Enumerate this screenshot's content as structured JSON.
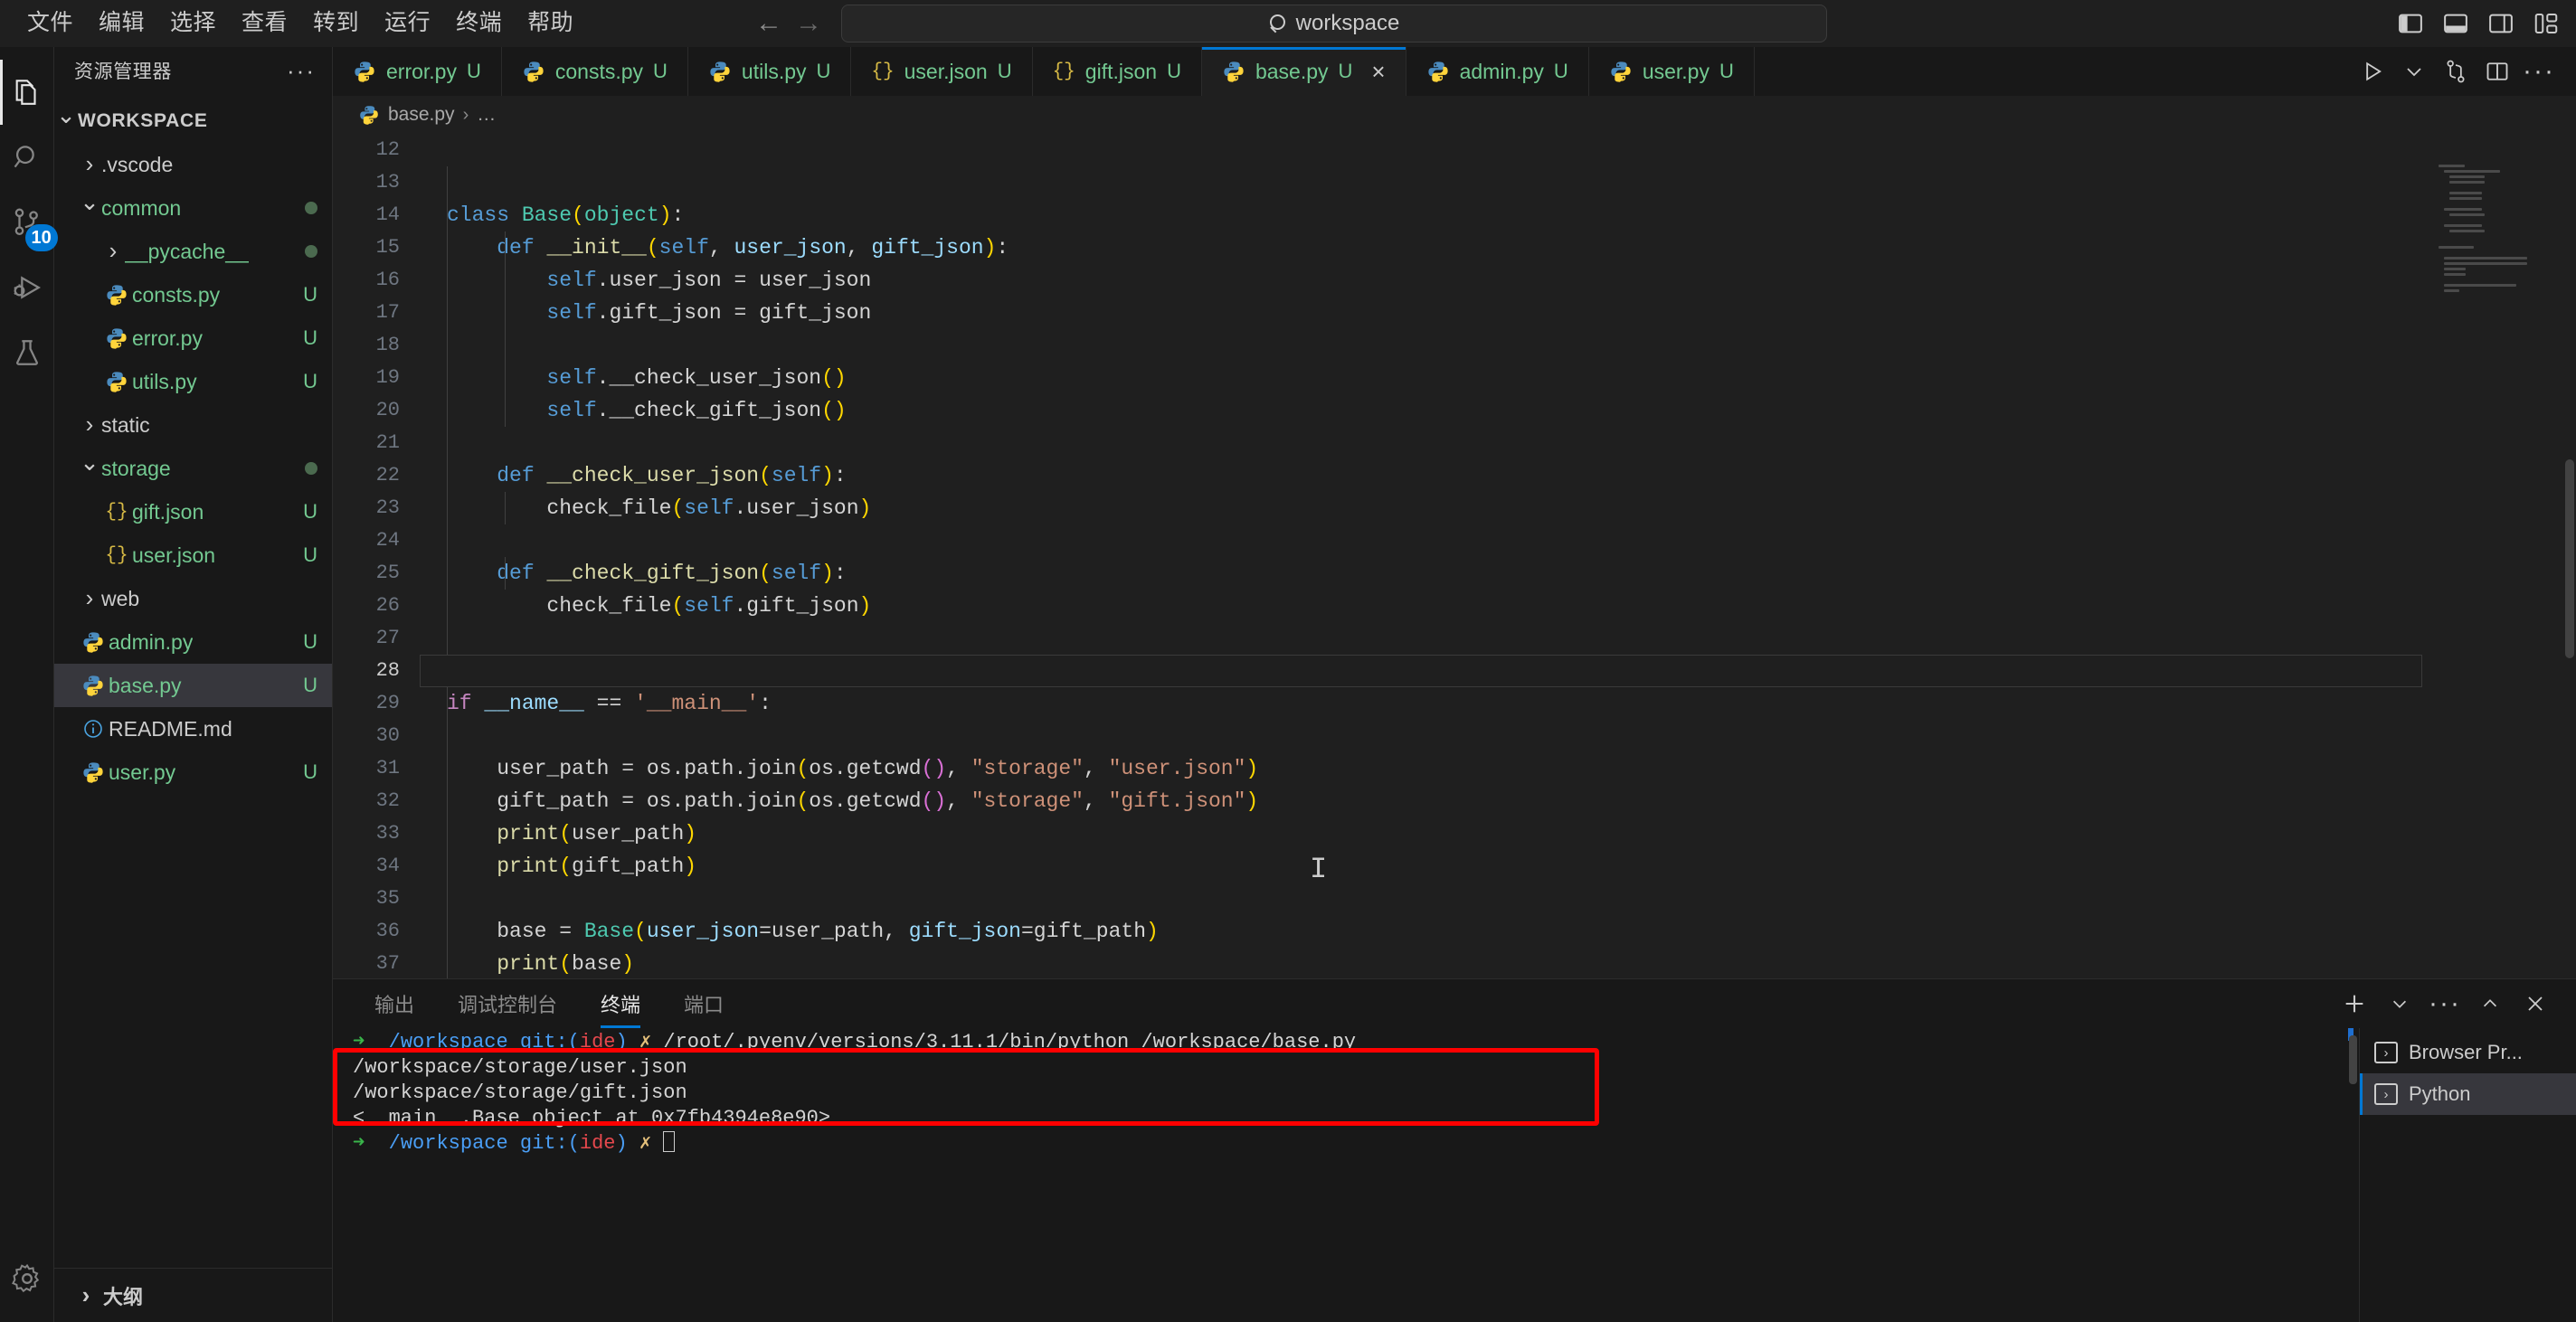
{
  "titlebar": {
    "menu": [
      "文件",
      "编辑",
      "选择",
      "查看",
      "转到",
      "运行",
      "终端",
      "帮助"
    ],
    "back_label": "←",
    "forward_label": "→",
    "command_center_text": "workspace",
    "layout_icons": [
      "toggle-primary-sidebar",
      "toggle-panel",
      "toggle-secondary-sidebar",
      "customize-layout"
    ]
  },
  "activitybar": {
    "items": [
      {
        "name": "explorer",
        "icon": "files-icon",
        "active": true,
        "badge": ""
      },
      {
        "name": "search",
        "icon": "search-icon",
        "active": false,
        "badge": ""
      },
      {
        "name": "source-control",
        "icon": "source-control-icon",
        "active": false,
        "badge": "10"
      },
      {
        "name": "run-and-debug",
        "icon": "run-debug-icon",
        "active": false,
        "badge": ""
      },
      {
        "name": "testing",
        "icon": "beaker-icon",
        "active": false,
        "badge": ""
      }
    ],
    "bottom": [
      {
        "name": "manage",
        "icon": "gear-icon"
      }
    ]
  },
  "sidebar": {
    "title": "资源管理器",
    "more_label": "···",
    "root": "WORKSPACE",
    "outline_label": "大纲",
    "tree": [
      {
        "label": ".vscode",
        "indent": 1,
        "type": "folder",
        "state": "collapsed",
        "color": "white",
        "badge": "",
        "dot": false,
        "selected": false
      },
      {
        "label": "common",
        "indent": 1,
        "type": "folder",
        "state": "expanded",
        "color": "green",
        "badge": "",
        "dot": true,
        "selected": false
      },
      {
        "label": "__pycache__",
        "indent": 2,
        "type": "folder",
        "state": "collapsed",
        "color": "green",
        "badge": "",
        "dot": true,
        "selected": false
      },
      {
        "label": "consts.py",
        "indent": 2,
        "type": "python",
        "state": "",
        "color": "green",
        "badge": "U",
        "dot": false,
        "selected": false
      },
      {
        "label": "error.py",
        "indent": 2,
        "type": "python",
        "state": "",
        "color": "green",
        "badge": "U",
        "dot": false,
        "selected": false
      },
      {
        "label": "utils.py",
        "indent": 2,
        "type": "python",
        "state": "",
        "color": "green",
        "badge": "U",
        "dot": false,
        "selected": false
      },
      {
        "label": "static",
        "indent": 1,
        "type": "folder",
        "state": "collapsed",
        "color": "white",
        "badge": "",
        "dot": false,
        "selected": false
      },
      {
        "label": "storage",
        "indent": 1,
        "type": "folder",
        "state": "expanded",
        "color": "green",
        "badge": "",
        "dot": true,
        "selected": false
      },
      {
        "label": "gift.json",
        "indent": 2,
        "type": "json",
        "state": "",
        "color": "green",
        "badge": "U",
        "dot": false,
        "selected": false
      },
      {
        "label": "user.json",
        "indent": 2,
        "type": "json",
        "state": "",
        "color": "green",
        "badge": "U",
        "dot": false,
        "selected": false
      },
      {
        "label": "web",
        "indent": 1,
        "type": "folder",
        "state": "collapsed",
        "color": "white",
        "badge": "",
        "dot": false,
        "selected": false
      },
      {
        "label": "admin.py",
        "indent": 1,
        "type": "python",
        "state": "",
        "color": "green",
        "badge": "U",
        "dot": false,
        "selected": false
      },
      {
        "label": "base.py",
        "indent": 1,
        "type": "python",
        "state": "",
        "color": "green",
        "badge": "U",
        "dot": false,
        "selected": true
      },
      {
        "label": "README.md",
        "indent": 1,
        "type": "md",
        "state": "",
        "color": "white",
        "badge": "",
        "dot": false,
        "selected": false
      },
      {
        "label": "user.py",
        "indent": 1,
        "type": "python",
        "state": "",
        "color": "green",
        "badge": "U",
        "dot": false,
        "selected": false
      }
    ]
  },
  "editor": {
    "tabs": [
      {
        "label": "error.py",
        "icon": "python-icon",
        "badge": "U",
        "active": false,
        "closable": false
      },
      {
        "label": "consts.py",
        "icon": "python-icon",
        "badge": "U",
        "active": false,
        "closable": false
      },
      {
        "label": "utils.py",
        "icon": "python-icon",
        "badge": "U",
        "active": false,
        "closable": false
      },
      {
        "label": "user.json",
        "icon": "json-icon",
        "badge": "U",
        "active": false,
        "closable": false
      },
      {
        "label": "gift.json",
        "icon": "json-icon",
        "badge": "U",
        "active": false,
        "closable": false
      },
      {
        "label": "base.py",
        "icon": "python-icon",
        "badge": "U",
        "active": true,
        "closable": true
      },
      {
        "label": "admin.py",
        "icon": "python-icon",
        "badge": "U",
        "active": false,
        "closable": false
      },
      {
        "label": "user.py",
        "icon": "python-icon",
        "badge": "U",
        "active": false,
        "closable": false
      }
    ],
    "tab_close_label": "×",
    "actions": [
      "run-python-file-icon",
      "chevron-down-icon",
      "split-branch-icon",
      "split-editor-icon",
      "more-actions-icon"
    ],
    "breadcrumb": {
      "file": "base.py",
      "separator": "›",
      "trail": "…"
    },
    "first_line_number": 12,
    "current_line": 28,
    "lines": [
      {
        "n": 12,
        "tokens": []
      },
      {
        "n": 13,
        "tokens": []
      },
      {
        "n": 14,
        "tokens": [
          {
            "t": "class ",
            "c": "k-kw"
          },
          {
            "t": "Base",
            "c": "k-cls"
          },
          {
            "t": "(",
            "c": "k-b1"
          },
          {
            "t": "object",
            "c": "k-cls"
          },
          {
            "t": ")",
            "c": "k-b1"
          },
          {
            "t": ":",
            "c": "k-txt"
          }
        ]
      },
      {
        "n": 15,
        "tokens": [
          {
            "t": "    ",
            "c": "k-txt"
          },
          {
            "t": "def ",
            "c": "k-kw"
          },
          {
            "t": "__init__",
            "c": "k-fn"
          },
          {
            "t": "(",
            "c": "k-b1"
          },
          {
            "t": "self",
            "c": "k-self"
          },
          {
            "t": ", ",
            "c": "k-txt"
          },
          {
            "t": "user_json",
            "c": "k-var"
          },
          {
            "t": ", ",
            "c": "k-txt"
          },
          {
            "t": "gift_json",
            "c": "k-var"
          },
          {
            "t": ")",
            "c": "k-b1"
          },
          {
            "t": ":",
            "c": "k-txt"
          }
        ]
      },
      {
        "n": 16,
        "tokens": [
          {
            "t": "        ",
            "c": "k-txt"
          },
          {
            "t": "self",
            "c": "k-self"
          },
          {
            "t": ".user_json = user_json",
            "c": "k-txt"
          }
        ]
      },
      {
        "n": 17,
        "tokens": [
          {
            "t": "        ",
            "c": "k-txt"
          },
          {
            "t": "self",
            "c": "k-self"
          },
          {
            "t": ".gift_json = gift_json",
            "c": "k-txt"
          }
        ]
      },
      {
        "n": 18,
        "tokens": []
      },
      {
        "n": 19,
        "tokens": [
          {
            "t": "        ",
            "c": "k-txt"
          },
          {
            "t": "self",
            "c": "k-self"
          },
          {
            "t": ".__check_user_json",
            "c": "k-txt"
          },
          {
            "t": "()",
            "c": "k-b1"
          }
        ]
      },
      {
        "n": 20,
        "tokens": [
          {
            "t": "        ",
            "c": "k-txt"
          },
          {
            "t": "self",
            "c": "k-self"
          },
          {
            "t": ".__check_gift_json",
            "c": "k-txt"
          },
          {
            "t": "()",
            "c": "k-b1"
          }
        ]
      },
      {
        "n": 21,
        "tokens": []
      },
      {
        "n": 22,
        "tokens": [
          {
            "t": "    ",
            "c": "k-txt"
          },
          {
            "t": "def ",
            "c": "k-kw"
          },
          {
            "t": "__check_user_json",
            "c": "k-fn"
          },
          {
            "t": "(",
            "c": "k-b1"
          },
          {
            "t": "self",
            "c": "k-self"
          },
          {
            "t": ")",
            "c": "k-b1"
          },
          {
            "t": ":",
            "c": "k-txt"
          }
        ]
      },
      {
        "n": 23,
        "tokens": [
          {
            "t": "        check_file",
            "c": "k-txt"
          },
          {
            "t": "(",
            "c": "k-b1"
          },
          {
            "t": "self",
            "c": "k-self"
          },
          {
            "t": ".user_json",
            "c": "k-txt"
          },
          {
            "t": ")",
            "c": "k-b1"
          }
        ]
      },
      {
        "n": 24,
        "tokens": []
      },
      {
        "n": 25,
        "tokens": [
          {
            "t": "    ",
            "c": "k-txt"
          },
          {
            "t": "def ",
            "c": "k-kw"
          },
          {
            "t": "__check_gift_json",
            "c": "k-fn"
          },
          {
            "t": "(",
            "c": "k-b1"
          },
          {
            "t": "self",
            "c": "k-self"
          },
          {
            "t": ")",
            "c": "k-b1"
          },
          {
            "t": ":",
            "c": "k-txt"
          }
        ]
      },
      {
        "n": 26,
        "tokens": [
          {
            "t": "        check_file",
            "c": "k-txt"
          },
          {
            "t": "(",
            "c": "k-b1"
          },
          {
            "t": "self",
            "c": "k-self"
          },
          {
            "t": ".gift_json",
            "c": "k-txt"
          },
          {
            "t": ")",
            "c": "k-b1"
          }
        ]
      },
      {
        "n": 27,
        "tokens": []
      },
      {
        "n": 28,
        "tokens": []
      },
      {
        "n": 29,
        "tokens": [
          {
            "t": "if ",
            "c": "k-ctrl"
          },
          {
            "t": "__name__",
            "c": "k-var"
          },
          {
            "t": " == ",
            "c": "k-txt"
          },
          {
            "t": "'__main__'",
            "c": "k-str"
          },
          {
            "t": ":",
            "c": "k-txt"
          }
        ]
      },
      {
        "n": 30,
        "tokens": []
      },
      {
        "n": 31,
        "tokens": [
          {
            "t": "    user_path = os.path.join",
            "c": "k-txt"
          },
          {
            "t": "(",
            "c": "k-b1"
          },
          {
            "t": "os.getcwd",
            "c": "k-txt"
          },
          {
            "t": "()",
            "c": "k-b2"
          },
          {
            "t": ", ",
            "c": "k-txt"
          },
          {
            "t": "\"storage\"",
            "c": "k-str"
          },
          {
            "t": ", ",
            "c": "k-txt"
          },
          {
            "t": "\"user.json\"",
            "c": "k-str"
          },
          {
            "t": ")",
            "c": "k-b1"
          }
        ]
      },
      {
        "n": 32,
        "tokens": [
          {
            "t": "    gift_path = os.path.join",
            "c": "k-txt"
          },
          {
            "t": "(",
            "c": "k-b1"
          },
          {
            "t": "os.getcwd",
            "c": "k-txt"
          },
          {
            "t": "()",
            "c": "k-b2"
          },
          {
            "t": ", ",
            "c": "k-txt"
          },
          {
            "t": "\"storage\"",
            "c": "k-str"
          },
          {
            "t": ", ",
            "c": "k-txt"
          },
          {
            "t": "\"gift.json\"",
            "c": "k-str"
          },
          {
            "t": ")",
            "c": "k-b1"
          }
        ]
      },
      {
        "n": 33,
        "tokens": [
          {
            "t": "    ",
            "c": "k-txt"
          },
          {
            "t": "print",
            "c": "k-fn"
          },
          {
            "t": "(",
            "c": "k-b1"
          },
          {
            "t": "user_path",
            "c": "k-txt"
          },
          {
            "t": ")",
            "c": "k-b1"
          }
        ]
      },
      {
        "n": 34,
        "tokens": [
          {
            "t": "    ",
            "c": "k-txt"
          },
          {
            "t": "print",
            "c": "k-fn"
          },
          {
            "t": "(",
            "c": "k-b1"
          },
          {
            "t": "gift_path",
            "c": "k-txt"
          },
          {
            "t": ")",
            "c": "k-b1"
          }
        ]
      },
      {
        "n": 35,
        "tokens": []
      },
      {
        "n": 36,
        "tokens": [
          {
            "t": "    base = ",
            "c": "k-txt"
          },
          {
            "t": "Base",
            "c": "k-cls"
          },
          {
            "t": "(",
            "c": "k-b1"
          },
          {
            "t": "user_json",
            "c": "k-var"
          },
          {
            "t": "=user_path, ",
            "c": "k-txt"
          },
          {
            "t": "gift_json",
            "c": "k-var"
          },
          {
            "t": "=gift_path",
            "c": "k-txt"
          },
          {
            "t": ")",
            "c": "k-b1"
          }
        ]
      },
      {
        "n": 37,
        "tokens": [
          {
            "t": "    ",
            "c": "k-txt"
          },
          {
            "t": "print",
            "c": "k-fn"
          },
          {
            "t": "(",
            "c": "k-b1"
          },
          {
            "t": "base",
            "c": "k-txt"
          },
          {
            "t": ")",
            "c": "k-b1"
          }
        ]
      }
    ]
  },
  "panel": {
    "tabs": [
      {
        "label": "输出",
        "active": false
      },
      {
        "label": "调试控制台",
        "active": false
      },
      {
        "label": "终端",
        "active": true
      },
      {
        "label": "端口",
        "active": false
      }
    ],
    "actions": [
      "add-terminal-icon",
      "chevron-down-icon",
      "more-actions-icon",
      "maximize-panel-icon",
      "close-panel-icon"
    ],
    "terminal": {
      "lines": [
        {
          "segments": [
            {
              "t": "➜  ",
              "c": "t-green"
            },
            {
              "t": "/workspace ",
              "c": "t-blue"
            },
            {
              "t": "git:(",
              "c": "t-blue"
            },
            {
              "t": "ide",
              "c": "t-red"
            },
            {
              "t": ") ",
              "c": "t-blue"
            },
            {
              "t": "✗ ",
              "c": "t-yellow"
            },
            {
              "t": "/root/.pyenv/versions/3.11.1/bin/python /workspace/base.py",
              "c": "t-white"
            }
          ]
        },
        {
          "segments": [
            {
              "t": "/workspace/storage/user.json",
              "c": "t-white"
            }
          ]
        },
        {
          "segments": [
            {
              "t": "/workspace/storage/gift.json",
              "c": "t-white"
            }
          ]
        },
        {
          "segments": [
            {
              "t": "<__main__.Base object at 0x7fb4394e8e90>",
              "c": "t-white"
            }
          ]
        },
        {
          "segments": [
            {
              "t": "➜  ",
              "c": "t-green"
            },
            {
              "t": "/workspace ",
              "c": "t-blue"
            },
            {
              "t": "git:(",
              "c": "t-blue"
            },
            {
              "t": "ide",
              "c": "t-red"
            },
            {
              "t": ") ",
              "c": "t-blue"
            },
            {
              "t": "✗ ",
              "c": "t-yellow"
            }
          ],
          "cursor": true
        }
      ]
    },
    "terminal_tabs": [
      {
        "label": "Browser Pr...",
        "active": false
      },
      {
        "label": "Python",
        "active": true
      }
    ]
  }
}
